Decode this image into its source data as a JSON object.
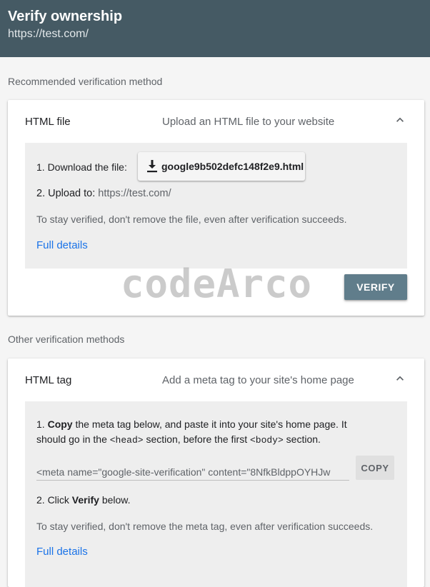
{
  "header": {
    "title": "Verify ownership",
    "subtitle": "https://test.com/"
  },
  "recommended": {
    "section_label": "Recommended verification method",
    "method_name": "HTML file",
    "method_description": "Upload an HTML file to your website",
    "step1_label": "1. Download the file:",
    "download_filename": "google9b502defc148f2e9.html",
    "step2_label": "2. Upload to:",
    "step2_url": "https://test.com/",
    "note": "To stay verified, don't remove the file, even after verification succeeds.",
    "full_details": "Full details",
    "verify_label": "VERIFY"
  },
  "watermark": "codeArco",
  "other": {
    "section_label": "Other verification methods",
    "method_name": "HTML tag",
    "method_description": "Add a meta tag to your site's home page",
    "step1_number": "1. ",
    "step1_bold": "Copy",
    "step1_text_a": " the meta tag below, and paste it into your site's home page. It",
    "step1_text_b": "should go in the ",
    "head_tag": "<head>",
    "step1_text_c": " section, before the first ",
    "body_tag": "<body>",
    "step1_text_d": " section.",
    "meta_value": "<meta name=\"google-site-verification\" content=\"8NfkBldppOYHJw",
    "copy_label": "COPY",
    "step2_number": "2. Click ",
    "step2_bold": "Verify",
    "step2_text": " below.",
    "note": "To stay verified, don't remove the meta tag, even after verification succeeds.",
    "full_details": "Full details"
  }
}
